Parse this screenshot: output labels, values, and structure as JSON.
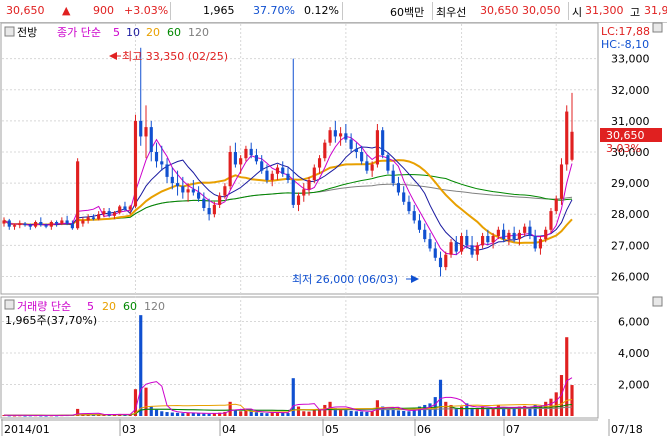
{
  "ticker_bar": {
    "price": "30,650",
    "up_arrow": "▲",
    "change": "900",
    "change_pct": "+3.03%",
    "volume": "1,965",
    "turnover_rate": "37.70%",
    "ratio": "0.12%",
    "unit_label": "60백만",
    "best_ask_label": "최우선",
    "best_ask": "30,650",
    "best_bid": "30,050",
    "open_label": "시",
    "open": "31,300",
    "high_label": "고",
    "high": "31,9"
  },
  "price_panel": {
    "tab_label": "전방",
    "ma_title": "종가 단순",
    "ma_periods": [
      "5",
      "10",
      "20",
      "60",
      "120"
    ],
    "lc_label": "LC:17,88",
    "hc_label": "HC:-8,10",
    "max_annotation": "최고 33,350 (02/25)",
    "min_annotation": "최저 26,000 (06/03)",
    "current_price_tag": "30,650",
    "current_pct_tag": "3.03%"
  },
  "volume_panel": {
    "title": "거래량 단순",
    "ma_periods": [
      "5",
      "20",
      "60",
      "120"
    ],
    "current_volume": "1,965주(37,70%)"
  },
  "colors": {
    "up": "#e02020",
    "down": "#1050d0",
    "ma5": "#cc00cc",
    "ma10": "#1a1aa0",
    "ma20": "#e8a000",
    "ma60": "#008800",
    "ma120": "#808080",
    "accent_box": "#e02020"
  },
  "chart_data": {
    "type": "candlestick",
    "x_axis_labels": [
      "2014/01",
      "03",
      "04",
      "05",
      "06",
      "07",
      "07/18"
    ],
    "price_axis_ticks": [
      26000,
      27000,
      28000,
      29000,
      30000,
      31000,
      32000,
      33000
    ],
    "price_ylim": [
      25500,
      33600
    ],
    "volume_axis_ticks": [
      2000,
      4000,
      6000
    ],
    "volume_ylim": [
      0,
      6600
    ],
    "candles": [
      [
        27700,
        27900,
        27600,
        27800
      ],
      [
        27800,
        27850,
        27500,
        27600
      ],
      [
        27600,
        27700,
        27500,
        27650
      ],
      [
        27650,
        27800,
        27550,
        27700
      ],
      [
        27700,
        27750,
        27600,
        27650
      ],
      [
        27650,
        27700,
        27500,
        27600
      ],
      [
        27600,
        27800,
        27550,
        27750
      ],
      [
        27750,
        27900,
        27600,
        27650
      ],
      [
        27650,
        27700,
        27550,
        27600
      ],
      [
        27600,
        27800,
        27500,
        27750
      ],
      [
        27750,
        27800,
        27600,
        27700
      ],
      [
        27700,
        27900,
        27650,
        27800
      ],
      [
        27800,
        27950,
        27650,
        27700
      ],
      [
        27700,
        27800,
        27500,
        27550
      ],
      [
        27550,
        29800,
        27500,
        29700
      ],
      [
        27700,
        27900,
        27600,
        27800
      ],
      [
        27800,
        28000,
        27700,
        27900
      ],
      [
        27900,
        28000,
        27800,
        27850
      ],
      [
        27850,
        28100,
        27800,
        28000
      ],
      [
        28000,
        28200,
        27900,
        28100
      ],
      [
        28100,
        28200,
        27900,
        27950
      ],
      [
        27950,
        28100,
        27850,
        28050
      ],
      [
        28050,
        28300,
        28000,
        28250
      ],
      [
        28250,
        28400,
        28100,
        28150
      ],
      [
        28150,
        28300,
        28000,
        28250
      ],
      [
        28250,
        31200,
        28200,
        31000
      ],
      [
        31000,
        33350,
        30200,
        30500
      ],
      [
        30500,
        31500,
        29800,
        30800
      ],
      [
        30800,
        31000,
        29700,
        30000
      ],
      [
        30000,
        30300,
        29500,
        29700
      ],
      [
        29700,
        30200,
        29400,
        29600
      ],
      [
        29600,
        29800,
        29000,
        29200
      ],
      [
        29200,
        29500,
        28800,
        29000
      ],
      [
        29000,
        29400,
        28600,
        28900
      ],
      [
        28900,
        29200,
        28500,
        28700
      ],
      [
        28700,
        29000,
        28400,
        28800
      ],
      [
        28800,
        29100,
        28600,
        28700
      ],
      [
        28700,
        28900,
        28400,
        28500
      ],
      [
        28500,
        28700,
        28100,
        28200
      ],
      [
        28200,
        28500,
        27800,
        28000
      ],
      [
        28000,
        28400,
        27900,
        28300
      ],
      [
        28300,
        28700,
        28200,
        28600
      ],
      [
        28600,
        29000,
        28500,
        28900
      ],
      [
        28900,
        30200,
        28800,
        30000
      ],
      [
        30000,
        30300,
        29500,
        29600
      ],
      [
        29600,
        29900,
        29300,
        29800
      ],
      [
        29800,
        30200,
        29700,
        30100
      ],
      [
        30100,
        30300,
        29800,
        29900
      ],
      [
        29900,
        30100,
        29600,
        29700
      ],
      [
        29700,
        29900,
        29300,
        29400
      ],
      [
        29400,
        29600,
        29000,
        29100
      ],
      [
        29100,
        29400,
        28900,
        29300
      ],
      [
        29300,
        29600,
        29100,
        29500
      ],
      [
        29500,
        29700,
        29200,
        29300
      ],
      [
        29300,
        29500,
        29000,
        29100
      ],
      [
        29100,
        33000,
        28200,
        28300
      ],
      [
        28300,
        28700,
        28100,
        28600
      ],
      [
        28600,
        29000,
        28400,
        28800
      ],
      [
        28800,
        29200,
        28600,
        29100
      ],
      [
        29100,
        29600,
        29000,
        29500
      ],
      [
        29500,
        29900,
        29300,
        29800
      ],
      [
        29800,
        30400,
        29700,
        30300
      ],
      [
        30300,
        30800,
        30200,
        30700
      ],
      [
        30700,
        31000,
        30300,
        30500
      ],
      [
        30500,
        30800,
        30200,
        30600
      ],
      [
        30600,
        30900,
        30300,
        30400
      ],
      [
        30400,
        30600,
        30000,
        30100
      ],
      [
        30100,
        30300,
        29800,
        30000
      ],
      [
        30000,
        30200,
        29600,
        29700
      ],
      [
        29700,
        29900,
        29300,
        29400
      ],
      [
        29400,
        29700,
        29200,
        29600
      ],
      [
        29600,
        30900,
        29500,
        30700
      ],
      [
        30700,
        30800,
        29800,
        29900
      ],
      [
        29900,
        30000,
        29300,
        29400
      ],
      [
        29400,
        29600,
        28900,
        29000
      ],
      [
        29000,
        29200,
        28600,
        28700
      ],
      [
        28700,
        28900,
        28300,
        28400
      ],
      [
        28400,
        28600,
        28000,
        28100
      ],
      [
        28100,
        28300,
        27700,
        27800
      ],
      [
        27800,
        28000,
        27400,
        27500
      ],
      [
        27500,
        27700,
        27100,
        27200
      ],
      [
        27200,
        27400,
        26800,
        26900
      ],
      [
        26900,
        27100,
        26500,
        26600
      ],
      [
        26600,
        26800,
        26000,
        26300
      ],
      [
        26300,
        26800,
        26200,
        26700
      ],
      [
        26700,
        27200,
        26600,
        27100
      ],
      [
        27100,
        27300,
        26700,
        26800
      ],
      [
        26800,
        27400,
        26700,
        27300
      ],
      [
        27300,
        27500,
        26900,
        27000
      ],
      [
        27000,
        27300,
        26600,
        26700
      ],
      [
        26700,
        27100,
        26500,
        27000
      ],
      [
        27000,
        27400,
        26900,
        27300
      ],
      [
        27300,
        27500,
        27000,
        27100
      ],
      [
        27100,
        27400,
        26900,
        27300
      ],
      [
        27300,
        27600,
        27200,
        27500
      ],
      [
        27500,
        27700,
        27100,
        27200
      ],
      [
        27200,
        27500,
        27000,
        27400
      ],
      [
        27400,
        27600,
        27100,
        27200
      ],
      [
        27200,
        27500,
        27000,
        27400
      ],
      [
        27400,
        27700,
        27300,
        27600
      ],
      [
        27600,
        27800,
        27200,
        27300
      ],
      [
        27300,
        27500,
        26800,
        26900
      ],
      [
        26900,
        27300,
        26700,
        27200
      ],
      [
        27200,
        27600,
        27100,
        27500
      ],
      [
        27500,
        28200,
        27400,
        28100
      ],
      [
        28100,
        28600,
        28000,
        28500
      ],
      [
        28500,
        29800,
        28300,
        29600
      ],
      [
        29600,
        31500,
        29400,
        31300
      ],
      [
        29750,
        31900,
        29700,
        30650
      ]
    ],
    "volume": [
      60,
      40,
      35,
      45,
      30,
      40,
      50,
      35,
      30,
      45,
      40,
      55,
      60,
      70,
      450,
      120,
      90,
      80,
      110,
      100,
      85,
      95,
      130,
      100,
      90,
      1700,
      6400,
      1800,
      600,
      400,
      300,
      250,
      220,
      200,
      180,
      200,
      190,
      160,
      150,
      140,
      170,
      210,
      260,
      900,
      400,
      300,
      350,
      280,
      240,
      200,
      180,
      220,
      260,
      210,
      190,
      2400,
      600,
      300,
      280,
      350,
      400,
      700,
      900,
      500,
      400,
      380,
      320,
      300,
      280,
      260,
      300,
      1000,
      600,
      420,
      380,
      350,
      320,
      300,
      420,
      600,
      700,
      800,
      1200,
      2300,
      900,
      700,
      500,
      600,
      800,
      520,
      450,
      600,
      500,
      540,
      700,
      480,
      500,
      520,
      600,
      640,
      550,
      700,
      600,
      900,
      1100,
      1500,
      2600,
      5000,
      1965
    ]
  }
}
